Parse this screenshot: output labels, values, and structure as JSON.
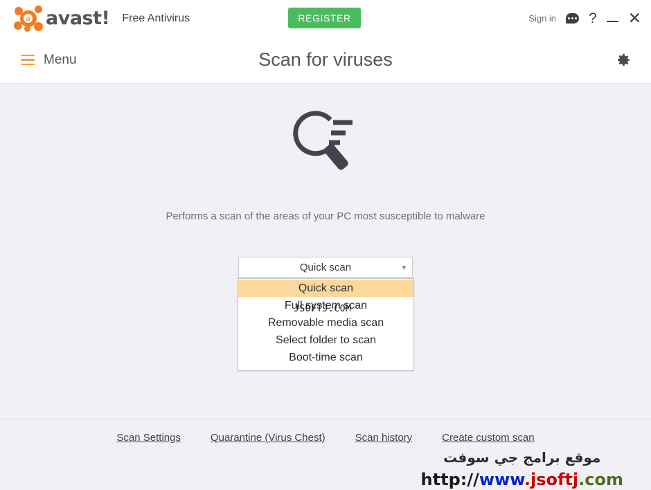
{
  "window": {
    "brand_word": "avast!",
    "brand_letter": "a",
    "product_name": "Free Antivirus",
    "register_label": "REGISTER",
    "sign_in_label": "Sign in",
    "chat_icon": "chat-bubble-icon",
    "help_icon": "question-mark-icon",
    "minimize_icon": "minimize-icon",
    "close_icon": "close-icon"
  },
  "nav": {
    "menu_label": "Menu",
    "menu_icon": "hamburger-icon",
    "page_title": "Scan for viruses",
    "settings_icon": "gear-icon"
  },
  "main": {
    "scan_icon": "magnifier-scan-icon",
    "description": "Performs a scan of the areas of your PC most susceptible to malware",
    "scan_select": {
      "selected": "Quick scan",
      "chevron_icon": "chevron-down-icon",
      "options": [
        "Quick scan",
        "Full system scan",
        "Removable media scan",
        "Select folder to scan",
        "Boot-time scan"
      ],
      "selected_index": 0
    }
  },
  "watermarks": {
    "list_overlay": "JSOFTJ.COM",
    "arabic_text": "موقع برامج جي سوفت",
    "url_parts": [
      {
        "text": "http://",
        "color": "#1a1a1a"
      },
      {
        "text": "www",
        "color": "#0022cc"
      },
      {
        "text": ".",
        "color": "#cc0000"
      },
      {
        "text": "jsoftj",
        "color": "#cc0000"
      },
      {
        "text": ".",
        "color": "#2f7a1e"
      },
      {
        "text": "com",
        "color": "#4f6b1f"
      }
    ]
  },
  "footer": {
    "links": [
      "Scan Settings",
      "Quarantine (Virus Chest)",
      "Scan history",
      "Create custom scan"
    ]
  },
  "colors": {
    "brand_orange": "#f47b20",
    "register_green": "#4cbb5f",
    "body_bg": "#f0f0f5",
    "highlight": "#fcd89b"
  }
}
